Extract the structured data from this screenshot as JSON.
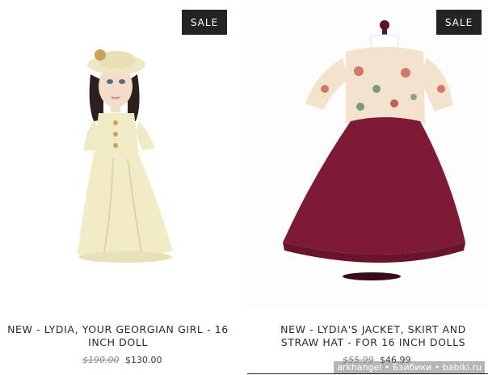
{
  "products": [
    {
      "badge": "SALE",
      "title": "NEW - LYDIA, YOUR GEORGIAN GIRL - 16 INCH DOLL",
      "price_old": "$190.00",
      "price_new": "$130.00",
      "image": "doll-in-cream-dress"
    },
    {
      "badge": "SALE",
      "title": "NEW - LYDIA'S JACKET, SKIRT AND STRAW HAT - FOR 16 INCH DOLLS",
      "price_old": "$55.99",
      "price_new": "$46.99",
      "image": "burgundy-skirt-floral-jacket-on-stand"
    }
  ],
  "watermark": "arkhangel • Бэйбики • babiki.ru",
  "colors": {
    "badge_bg": "#232323",
    "skirt": "#7e1a35",
    "cream_dress": "#f2ecc6"
  }
}
